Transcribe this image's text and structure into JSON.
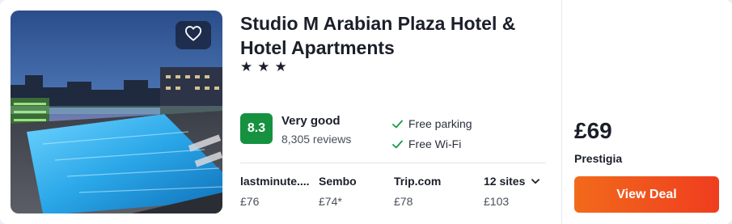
{
  "hotel": {
    "name": "Studio M Arabian Plaza Hotel & Hotel Apartments",
    "stars": "★★★",
    "star_count": 3
  },
  "rating": {
    "score": "8.3",
    "label": "Very good",
    "reviews": "8,305 reviews",
    "badge_color": "#15913f"
  },
  "amenities": [
    {
      "label": "Free parking",
      "icon": "check-icon"
    },
    {
      "label": "Free Wi-Fi",
      "icon": "check-icon"
    }
  ],
  "providers": [
    {
      "name": "lastminute....",
      "price": "£76"
    },
    {
      "name": "Sembo",
      "price": "£74*"
    },
    {
      "name": "Trip.com",
      "price": "£78"
    }
  ],
  "more_sites": {
    "label": "12 sites",
    "price": "£103",
    "icon": "chevron-down-icon"
  },
  "deal": {
    "price": "£69",
    "provider": "Prestigia",
    "button_label": "View Deal",
    "button_color": "#f0541d"
  },
  "favourite": {
    "icon": "heart-icon"
  }
}
